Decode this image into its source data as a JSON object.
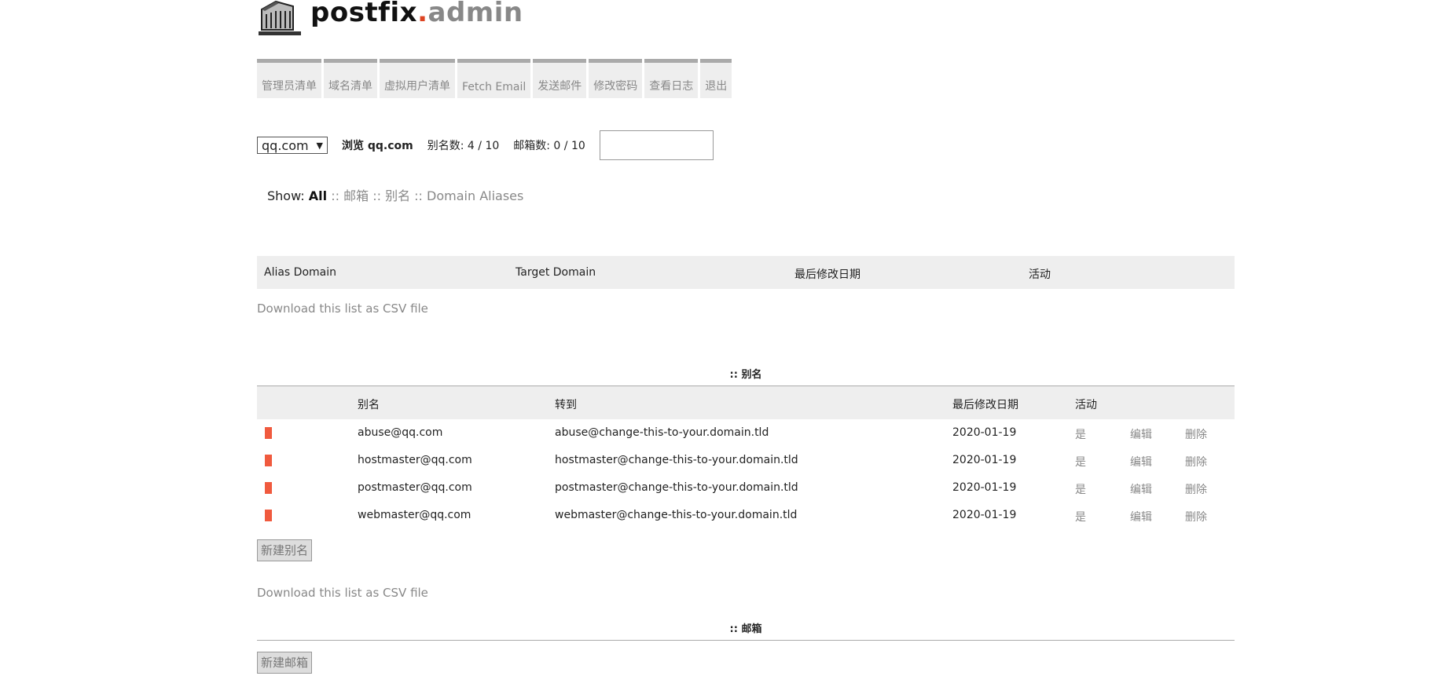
{
  "logo": {
    "part1": "postfix",
    "dot": ".",
    "part2": "admin",
    "icon": "mailbox-icon"
  },
  "menu": [
    {
      "label": "管理员清单"
    },
    {
      "label": "域名清单"
    },
    {
      "label": "虚拟用户清单"
    },
    {
      "label": "Fetch Email"
    },
    {
      "label": "发送邮件"
    },
    {
      "label": "修改密码"
    },
    {
      "label": "查看日志"
    },
    {
      "label": "退出"
    }
  ],
  "domain_bar": {
    "selected_domain": "qq.com",
    "browse_label": "浏览 qq.com",
    "alias_count": "别名数: 4 / 10",
    "mailbox_count": "邮箱数: 0 / 10",
    "search_value": ""
  },
  "show": {
    "label": "Show:",
    "all": "All",
    "sep1": " :: ",
    "mailboxes": "邮箱",
    "sep2": " :: ",
    "aliases": "别名",
    "sep3": " :: ",
    "domain_aliases": "Domain Aliases"
  },
  "alias_domains": {
    "headers": {
      "alias_domain": "Alias Domain",
      "target_domain": "Target Domain",
      "modified": "最后修改日期",
      "active": "活动"
    },
    "csv": "Download this list as CSV file"
  },
  "aliases": {
    "title": ":: 别名",
    "headers": {
      "alias": "别名",
      "goto": "转到",
      "modified": "最后修改日期",
      "active": "活动"
    },
    "rows": [
      {
        "address": "abuse@qq.com",
        "goto": "abuse@change-this-to-your.domain.tld",
        "modified": "2020-01-19",
        "active": "是",
        "edit": "编辑",
        "delete": "删除"
      },
      {
        "address": "hostmaster@qq.com",
        "goto": "hostmaster@change-this-to-your.domain.tld",
        "modified": "2020-01-19",
        "active": "是",
        "edit": "编辑",
        "delete": "删除"
      },
      {
        "address": "postmaster@qq.com",
        "goto": "postmaster@change-this-to-your.domain.tld",
        "modified": "2020-01-19",
        "active": "是",
        "edit": "编辑",
        "delete": "删除"
      },
      {
        "address": "webmaster@qq.com",
        "goto": "webmaster@change-this-to-your.domain.tld",
        "modified": "2020-01-19",
        "active": "是",
        "edit": "编辑",
        "delete": "删除"
      }
    ],
    "new_button": "新建别名",
    "csv": "Download this list as CSV file"
  },
  "mailboxes": {
    "title": ":: 邮箱",
    "new_button": "新建邮箱"
  },
  "colors": {
    "flag": "#f05a3e",
    "menu_bg": "#eeeeee",
    "menu_border": "#aaaaaa",
    "link": "#888888"
  }
}
